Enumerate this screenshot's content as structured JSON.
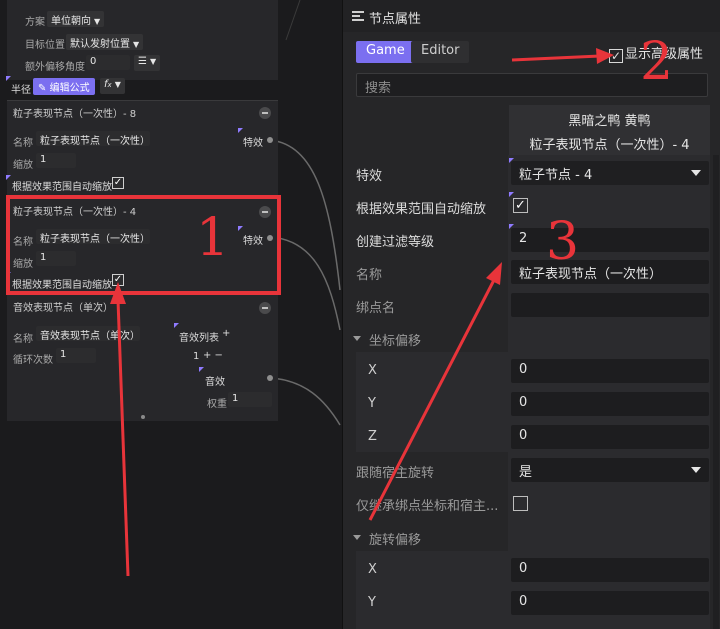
{
  "graph": {
    "top_rows": [
      {
        "label": "方案",
        "value": "单位朝向"
      },
      {
        "label": "目标位置",
        "value": "默认发射位置"
      },
      {
        "label": "额外偏移角度",
        "value": "0"
      }
    ],
    "radius_label": "半径",
    "edit_formula_label": "编辑公式",
    "fx_label": "f",
    "node1": {
      "title": "粒子表现节点（一次性）- 8",
      "name_label": "名称",
      "name_value": "粒子表现节点（一次性）",
      "scale_label": "缩放",
      "scale_value": "1",
      "effect_label": "特效",
      "auto_scale_label": "根据效果范围自动缩放"
    },
    "node2": {
      "title": "粒子表现节点（一次性）- 4",
      "name_label": "名称",
      "name_value": "粒子表现节点（一次性）",
      "scale_label": "缩放",
      "scale_value": "1",
      "effect_label": "特效",
      "auto_scale_label": "根据效果范围自动缩放"
    },
    "node3": {
      "title": "音效表现节点（单次）",
      "name_label": "名称",
      "name_value": "音效表现节点（单次）",
      "loop_label": "循环次数",
      "loop_value": "1",
      "sound_list_label": "音效列表",
      "plus": "+",
      "list_index": "1",
      "plus_minus": "+ −",
      "sound_label": "音效",
      "weight_label": "权重",
      "weight_value": "1"
    },
    "annotation_1": "1"
  },
  "panel": {
    "title": "节点属性",
    "tabs": [
      "Game",
      "Editor"
    ],
    "advanced_label": "显示高级属性",
    "search_placeholder": "搜索",
    "header_line1": "黑暗之鸭 黄鸭",
    "header_line2": "粒子表现节点（一次性）- 4",
    "effect_label": "特效",
    "effect_value": "粒子节点 - 4",
    "auto_scale_label": "根据效果范围自动缩放",
    "filter_label": "创建过滤等级",
    "filter_value": "2",
    "name_label": "名称",
    "name_value": "粒子表现节点（一次性）",
    "bind_label": "绑点名",
    "coord_offset_label": "坐标偏移",
    "x_label": "X",
    "x_value": "0",
    "y_label": "Y",
    "y_value": "0",
    "z_label": "Z",
    "z_value": "0",
    "follow_rotate_label": "跟随宿主旋转",
    "follow_rotate_value": "是",
    "inherit_label": "仅继承绑点坐标和宿主...",
    "rot_offset_label": "旋转偏移",
    "rx_label": "X",
    "rx_value": "0",
    "ry_label": "Y",
    "ry_value": "0",
    "annotation_2": "2",
    "annotation_3": "3"
  },
  "colors": {
    "accent": "#7b6ff0",
    "annotation_red": "#e8343a"
  }
}
